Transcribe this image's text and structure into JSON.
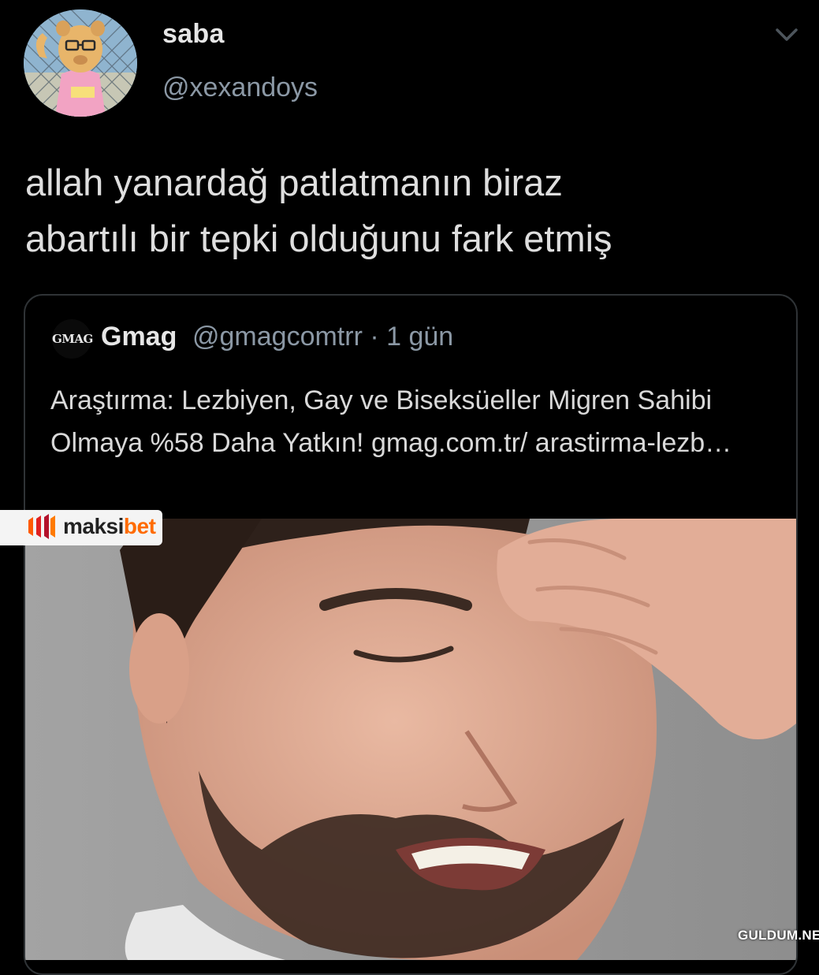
{
  "tweet": {
    "display_name": "saba",
    "handle": "@xexandoys",
    "text": "allah yanardağ patlatmanın biraz\nabartılı bir tepki olduğunu fark etmiş",
    "menu_icon": "chevron-down-icon"
  },
  "quoted_tweet": {
    "avatar_text": "GMAG",
    "display_name": "Gmag",
    "handle": "@gmagcomtrr",
    "separator": "·",
    "time": "1 gün",
    "text": "Araştırma: Lezbiyen, Gay ve Biseksüeller Migren Sahibi Olmaya %58 Daha Yatkın! gmag.com.tr/ arastirma-lezb…",
    "media": "photo of a man with headache holding his forehead"
  },
  "overlay": {
    "brand_prefix": "maksi",
    "brand_suffix": "bet",
    "watermark": "GULDUM.NET"
  },
  "colors": {
    "background": "#000000",
    "text": "#d9d9d9",
    "secondary_text": "#8b98a5",
    "border": "#2f3336",
    "brand_accent": "#ff6b00"
  }
}
